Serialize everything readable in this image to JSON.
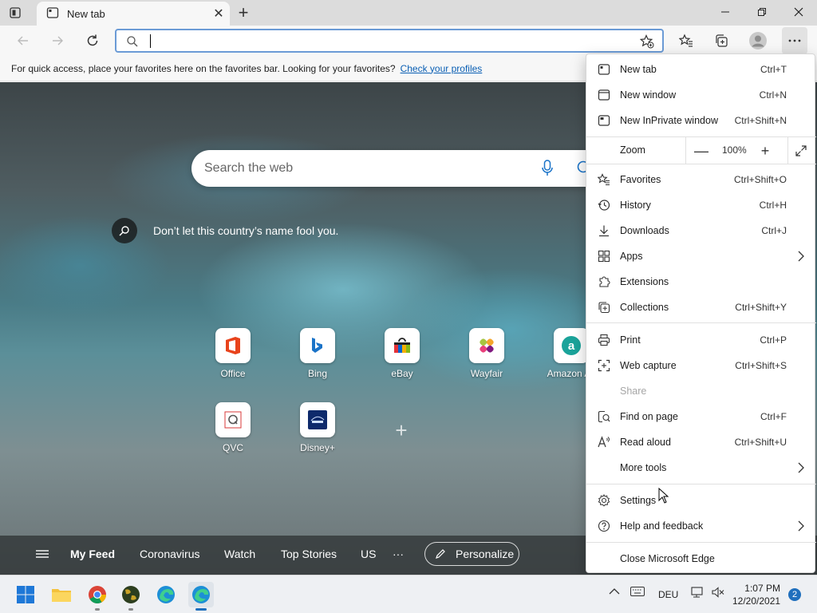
{
  "tab": {
    "title": "New tab"
  },
  "address": {
    "value": "",
    "placeholder": ""
  },
  "favorites_bar": {
    "message": "For quick access, place your favorites here on the favorites bar. Looking for your favorites?",
    "link": "Check your profiles"
  },
  "search": {
    "placeholder": "Search the web"
  },
  "fact": {
    "text": "Don’t let this country’s name fool you."
  },
  "tiles": [
    {
      "label": "Office"
    },
    {
      "label": "Bing"
    },
    {
      "label": "eBay"
    },
    {
      "label": "Wayfair"
    },
    {
      "label": "Amazon As"
    },
    {
      "label": "QVC"
    },
    {
      "label": "Disney+"
    }
  ],
  "feed": {
    "items": [
      "My Feed",
      "Coronavirus",
      "Watch",
      "Top Stories",
      "US"
    ],
    "more": "···",
    "personalize": "Personalize"
  },
  "menu": {
    "new_tab": {
      "label": "New tab",
      "shortcut": "Ctrl+T"
    },
    "new_window": {
      "label": "New window",
      "shortcut": "Ctrl+N"
    },
    "new_inprivate": {
      "label": "New InPrivate window",
      "shortcut": "Ctrl+Shift+N"
    },
    "zoom": {
      "label": "Zoom",
      "minus": "—",
      "value": "100%",
      "plus": "+"
    },
    "favorites": {
      "label": "Favorites",
      "shortcut": "Ctrl+Shift+O"
    },
    "history": {
      "label": "History",
      "shortcut": "Ctrl+H"
    },
    "downloads": {
      "label": "Downloads",
      "shortcut": "Ctrl+J"
    },
    "apps": {
      "label": "Apps"
    },
    "extensions": {
      "label": "Extensions"
    },
    "collections": {
      "label": "Collections",
      "shortcut": "Ctrl+Shift+Y"
    },
    "print": {
      "label": "Print",
      "shortcut": "Ctrl+P"
    },
    "web_capture": {
      "label": "Web capture",
      "shortcut": "Ctrl+Shift+S"
    },
    "share": {
      "label": "Share"
    },
    "find": {
      "label": "Find on page",
      "shortcut": "Ctrl+F"
    },
    "read_aloud": {
      "label": "Read aloud",
      "shortcut": "Ctrl+Shift+U"
    },
    "more_tools": {
      "label": "More tools"
    },
    "settings": {
      "label": "Settings"
    },
    "help": {
      "label": "Help and feedback"
    },
    "close": {
      "label": "Close Microsoft Edge"
    }
  },
  "taskbar": {
    "language": "DEU",
    "time": "1:07 PM",
    "date": "12/20/2021",
    "notifications": "2"
  },
  "colors": {
    "accent": "#0a5fb4",
    "address_border": "#6b9bd6",
    "badge": "#1f6fbd"
  }
}
